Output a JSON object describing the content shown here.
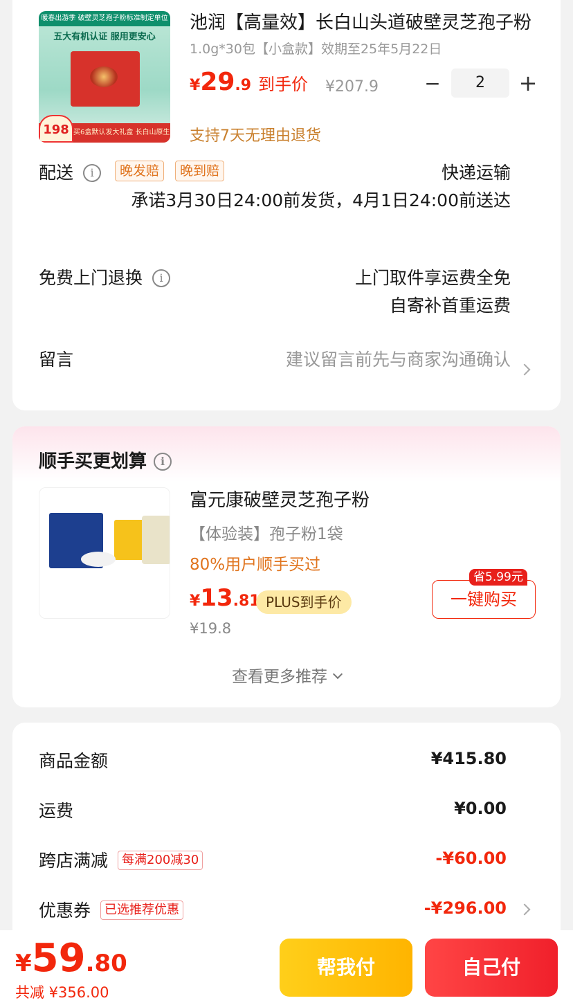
{
  "product": {
    "title": "池润【高量效】长白山头道破壁灵芝孢子粉",
    "spec": "1.0g*30包【小盒款】效期至25年5月22日",
    "price_symbol": "¥",
    "price_int": "29",
    "price_dec": ".9",
    "price_label": "到手价",
    "original_price": "¥207.9",
    "quantity": "2",
    "minus": "−",
    "plus": "+",
    "return_policy": "支持7天无理由退货",
    "thumb_banner": "暖春出游季  破壁灵芝孢子粉标准制定单位",
    "thumb_headline": "五大有机认证 服用更安心",
    "thumb_promo": "买6盒默认发大礼盒  长白山原生高品质灵芝制剂",
    "thumb_badge": "198"
  },
  "delivery": {
    "label": "配送",
    "tags": [
      "晚发赔",
      "晚到赔"
    ],
    "method": "快递运输",
    "promise": "承诺3月30日24:00前发货，4月1日24:00前送达"
  },
  "returns": {
    "label": "免费上门退换",
    "line1": "上门取件享运费全免",
    "line2": "自寄补首重运费"
  },
  "note": {
    "label": "留言",
    "placeholder": "建议留言前先与商家沟通确认"
  },
  "addon": {
    "section_title": "顺手买更划算",
    "title": "富元康破壁灵芝孢子粉",
    "spec": "【体验装】孢子粉1袋",
    "users": "80%用户顺手买过",
    "price_symbol": "¥",
    "price_int": "13",
    "price_dec": ".81",
    "plus_label": "PLUS到手价",
    "original_price": "¥19.8",
    "save_tag": "省5.99元",
    "buy_label": "一键购买",
    "more_label": "查看更多推荐"
  },
  "summary": {
    "goods_label": "商品金额",
    "goods_value": "¥415.80",
    "shipping_label": "运费",
    "shipping_value": "¥0.00",
    "cross_label": "跨店满减",
    "cross_tag": "每满200减30",
    "cross_value": "-¥60.00",
    "coupon_label": "优惠券",
    "coupon_tag": "已选推荐优惠",
    "coupon_value": "-¥296.00"
  },
  "checkout": {
    "total_symbol": "¥",
    "total_int": "59",
    "total_dec": ".80",
    "saved": "共减 ¥356.00",
    "help_pay": "帮我付",
    "self_pay": "自己付"
  },
  "colors": {
    "accent_red": "#f2270c",
    "accent_orange": "#e0741e",
    "help_yellow": "#ffc000"
  },
  "icons": [
    "info-icon",
    "chevron-right-icon",
    "chevron-down-icon"
  ]
}
